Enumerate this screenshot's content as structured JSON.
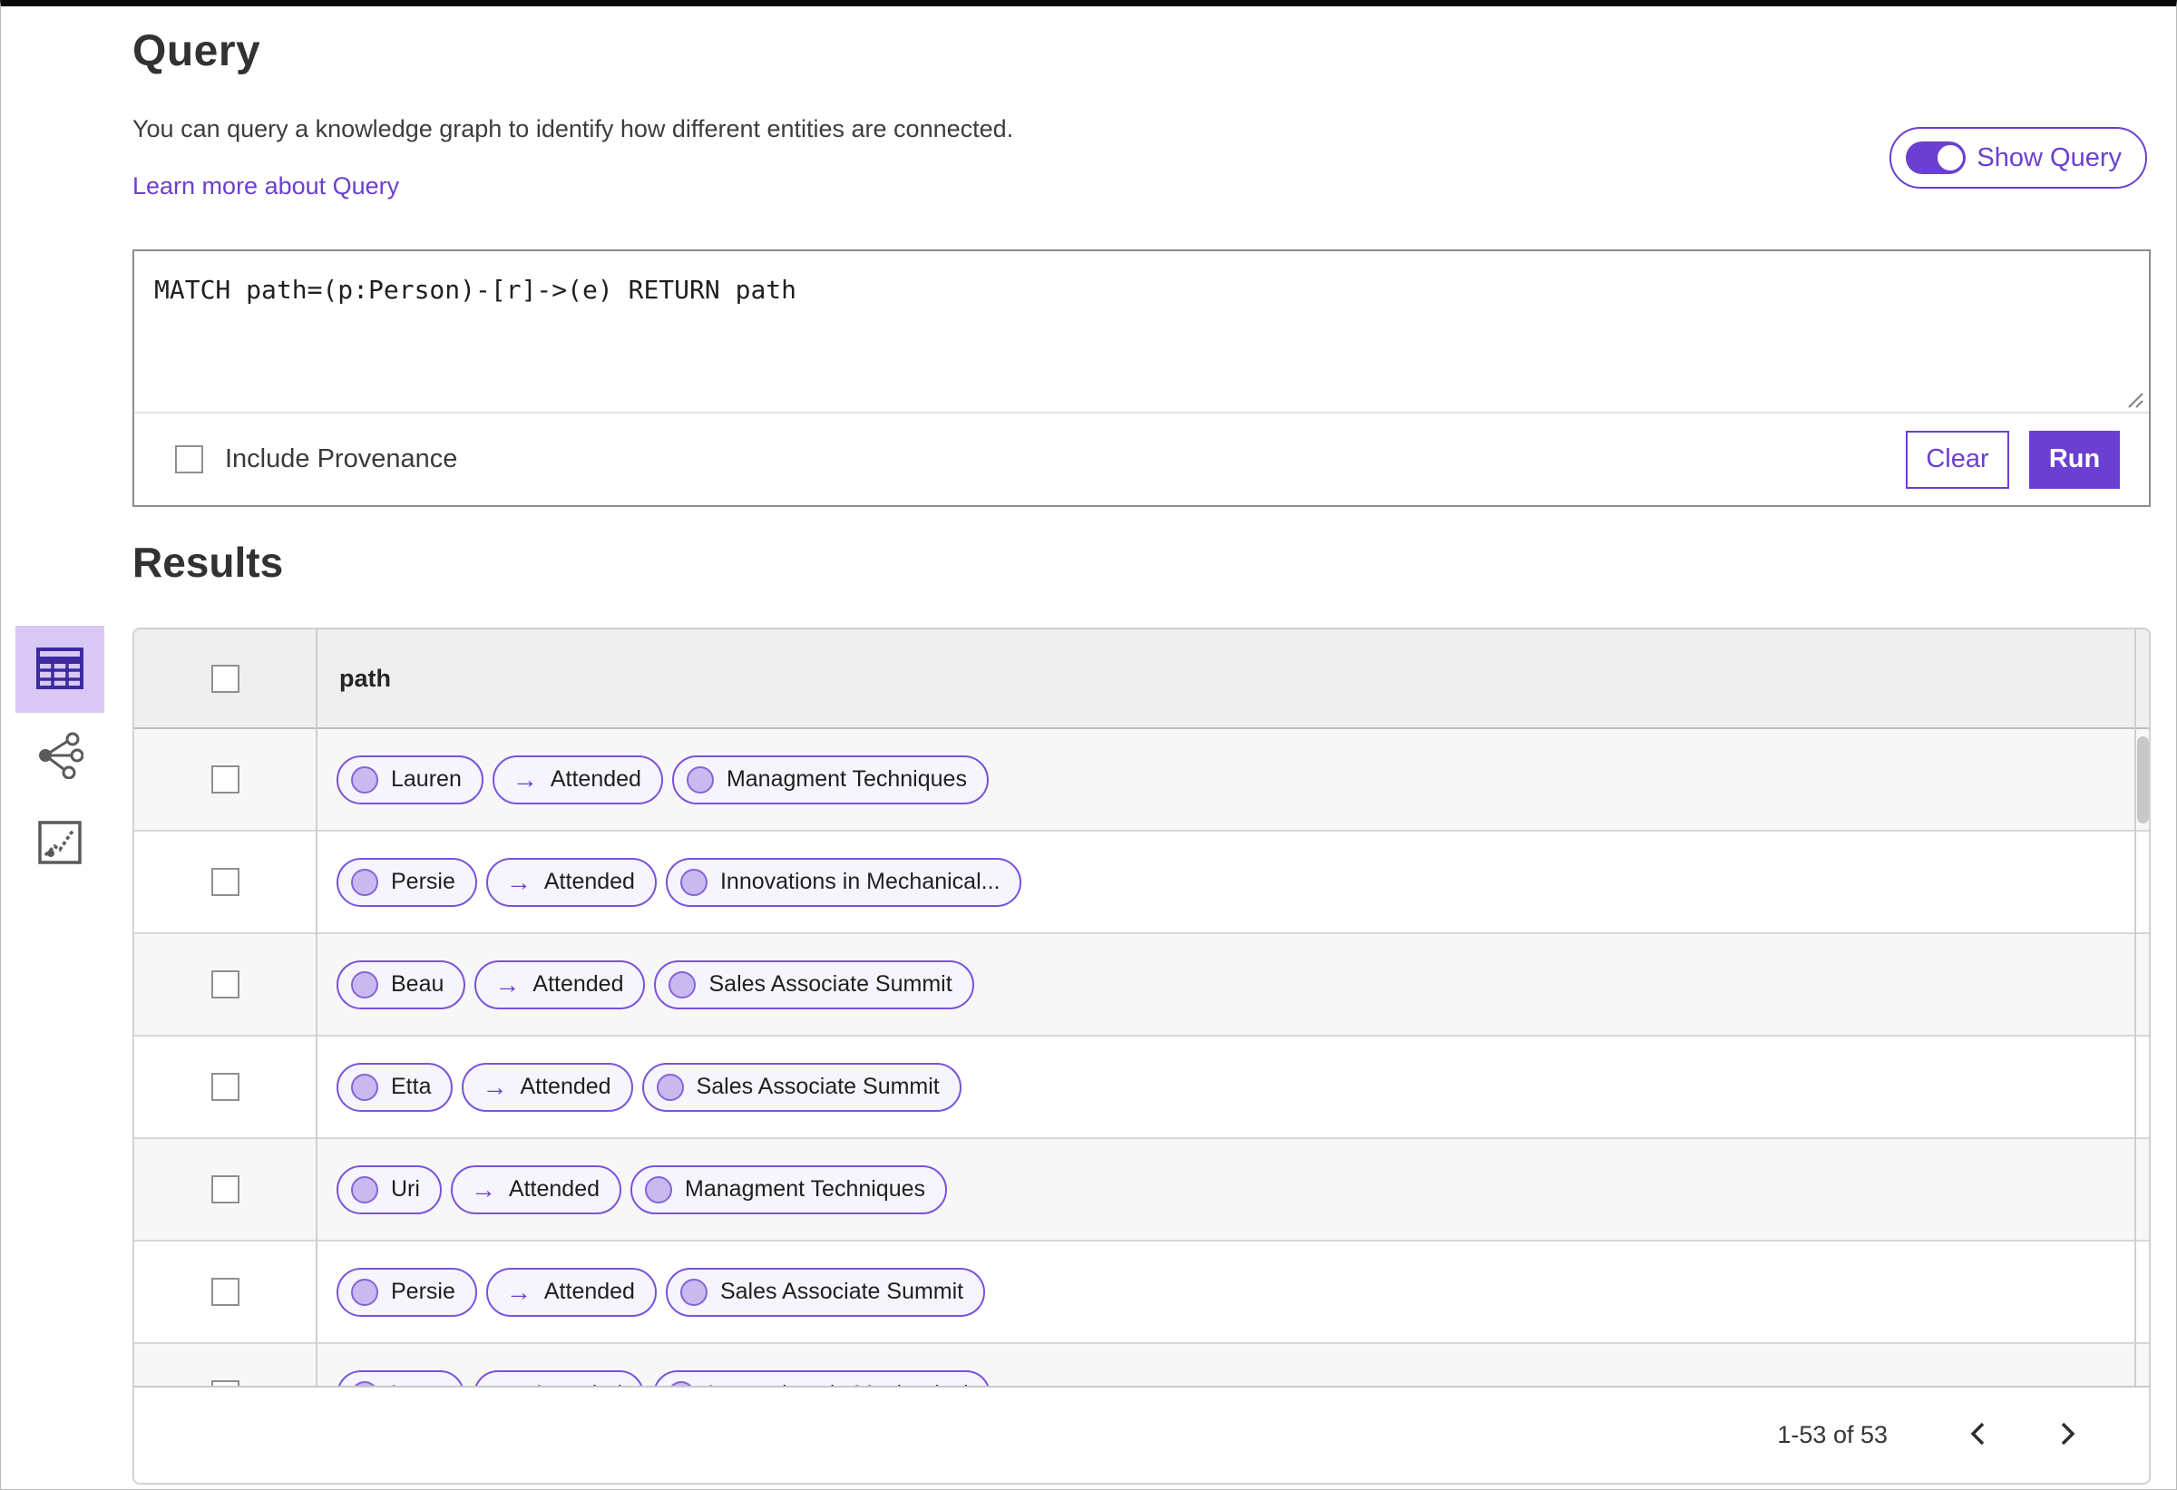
{
  "header": {
    "title": "Query",
    "description": "You can query a knowledge graph to identify how different entities are connected.",
    "learn_more_label": "Learn more about Query",
    "show_query_label": "Show Query",
    "show_query_on": true
  },
  "query_editor": {
    "query_text": "MATCH path=(p:Person)-[r]->(e) RETURN path",
    "include_provenance_label": "Include Provenance",
    "include_provenance_checked": false,
    "clear_button_label": "Clear",
    "run_button_label": "Run"
  },
  "results": {
    "title": "Results",
    "path_column_header": "path",
    "edge_arrow": "→",
    "view_switcher": [
      {
        "name": "table-view-icon",
        "selected": true
      },
      {
        "name": "graph-view-icon",
        "selected": false
      },
      {
        "name": "chart-view-icon",
        "selected": false
      }
    ],
    "rows": [
      {
        "source": "Lauren",
        "edge": "Attended",
        "target": "Managment Techniques"
      },
      {
        "source": "Persie",
        "edge": "Attended",
        "target": "Innovations in Mechanical..."
      },
      {
        "source": "Beau",
        "edge": "Attended",
        "target": "Sales Associate Summit"
      },
      {
        "source": "Etta",
        "edge": "Attended",
        "target": "Sales Associate Summit"
      },
      {
        "source": "Uri",
        "edge": "Attended",
        "target": "Managment Techniques"
      },
      {
        "source": "Persie",
        "edge": "Attended",
        "target": "Sales Associate Summit"
      },
      {
        "source": "Larry",
        "edge": "Attended",
        "target": "Innovations in Mechanical"
      }
    ],
    "pagination": {
      "range_label": "1-53 of 53"
    }
  },
  "colors": {
    "accent_purple": "#6b3fd1",
    "pill_border": "#7a52dd",
    "pill_background": "#f6f4fc",
    "node_circle_fill": "#c9b9ee",
    "header_row_background": "#efefef",
    "row_alternate_background": "#f7f7f8",
    "selected_view_background": "#d9c8f4"
  }
}
